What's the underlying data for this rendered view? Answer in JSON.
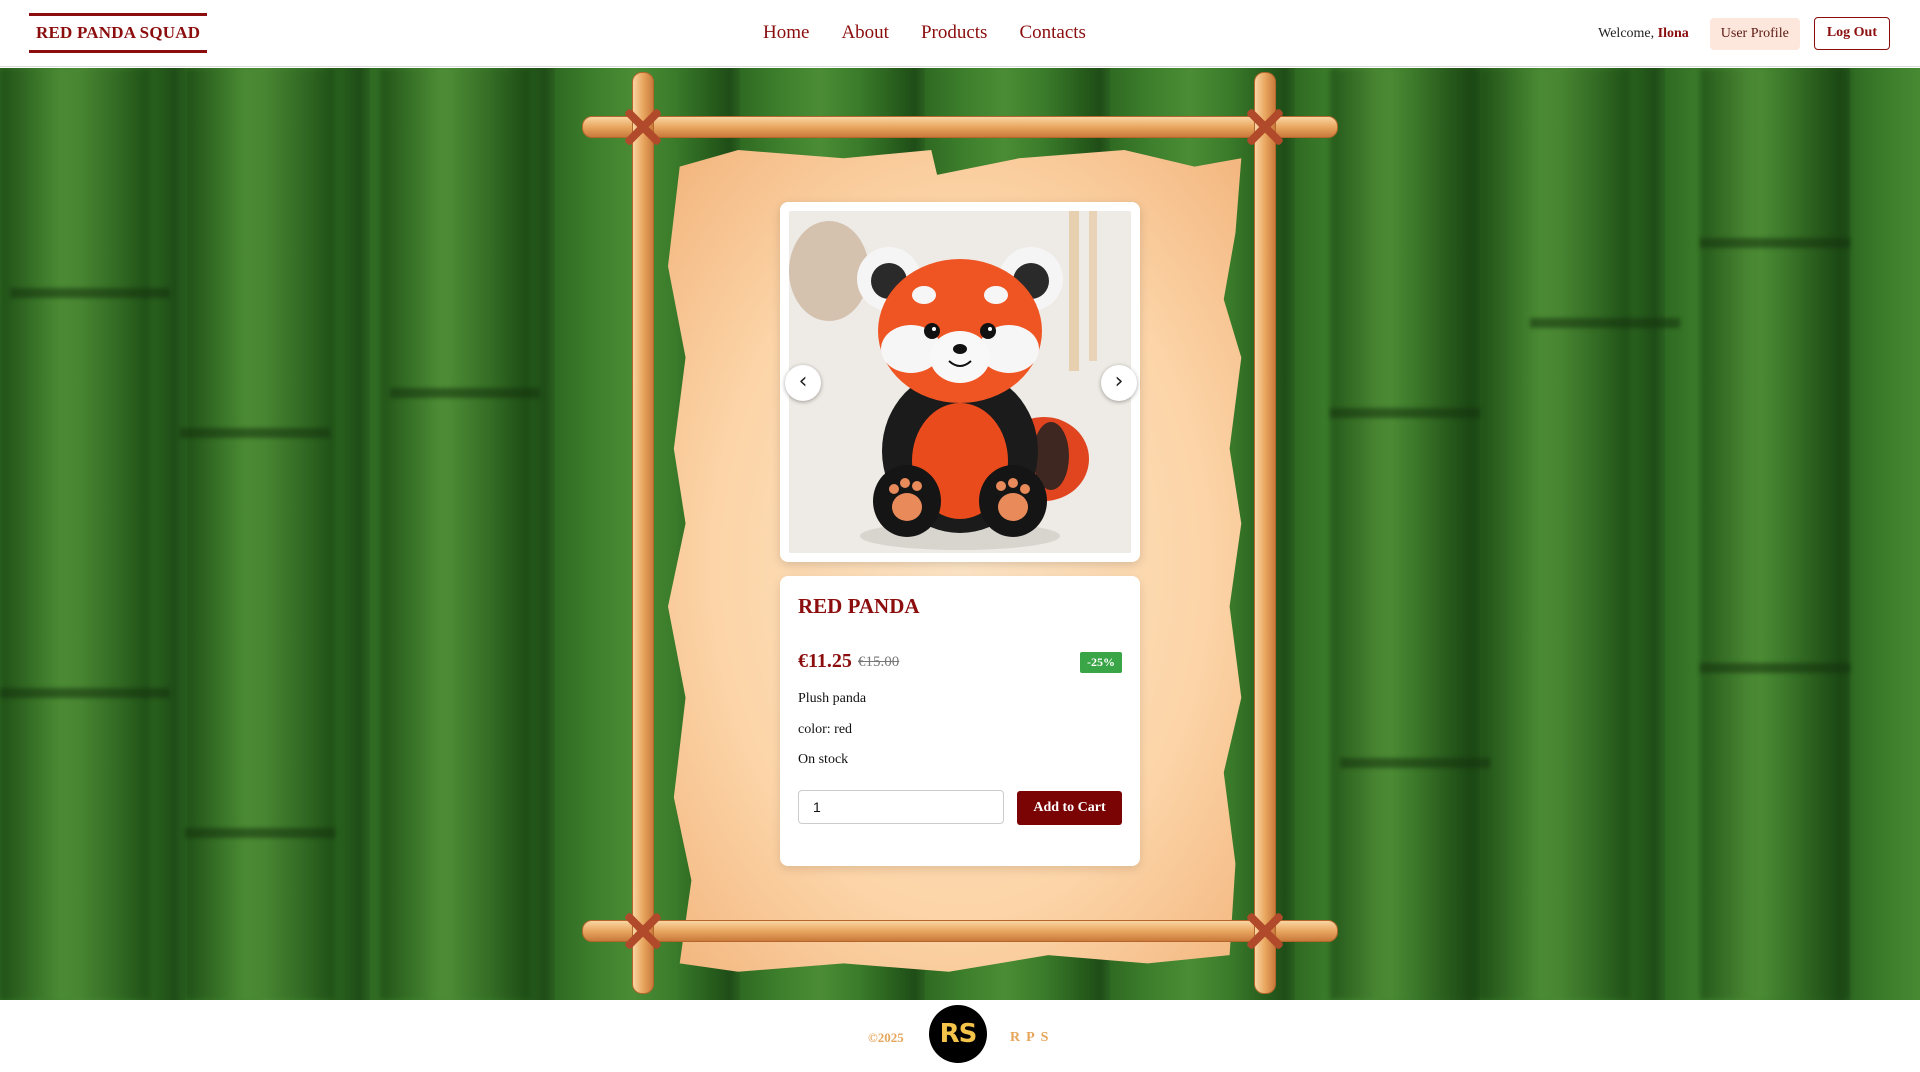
{
  "header": {
    "logo": "RED PANDA SQUAD",
    "nav": [
      "Home",
      "About",
      "Products",
      "Contacts"
    ],
    "welcome_prefix": "Welcome,",
    "username": "Ilona",
    "profile_label": "User Profile",
    "logout_label": "Log Out"
  },
  "product": {
    "title": "RED PANDA",
    "price": "€11.25",
    "old_price": "€15.00",
    "discount": "-25%",
    "description": "Plush panda",
    "color": "color: red",
    "stock": "On stock",
    "quantity": "1",
    "add_to_cart": "Add to Cart"
  },
  "carousel": {
    "prev": "‹",
    "next": "›"
  },
  "footer": {
    "year": "©2025",
    "logo": "RS",
    "brand": "RPS"
  },
  "colors": {
    "brand": "#8b0d0d",
    "button": "#7a0404",
    "badge": "#3aa546",
    "footer_accent": "#e6a55a"
  }
}
